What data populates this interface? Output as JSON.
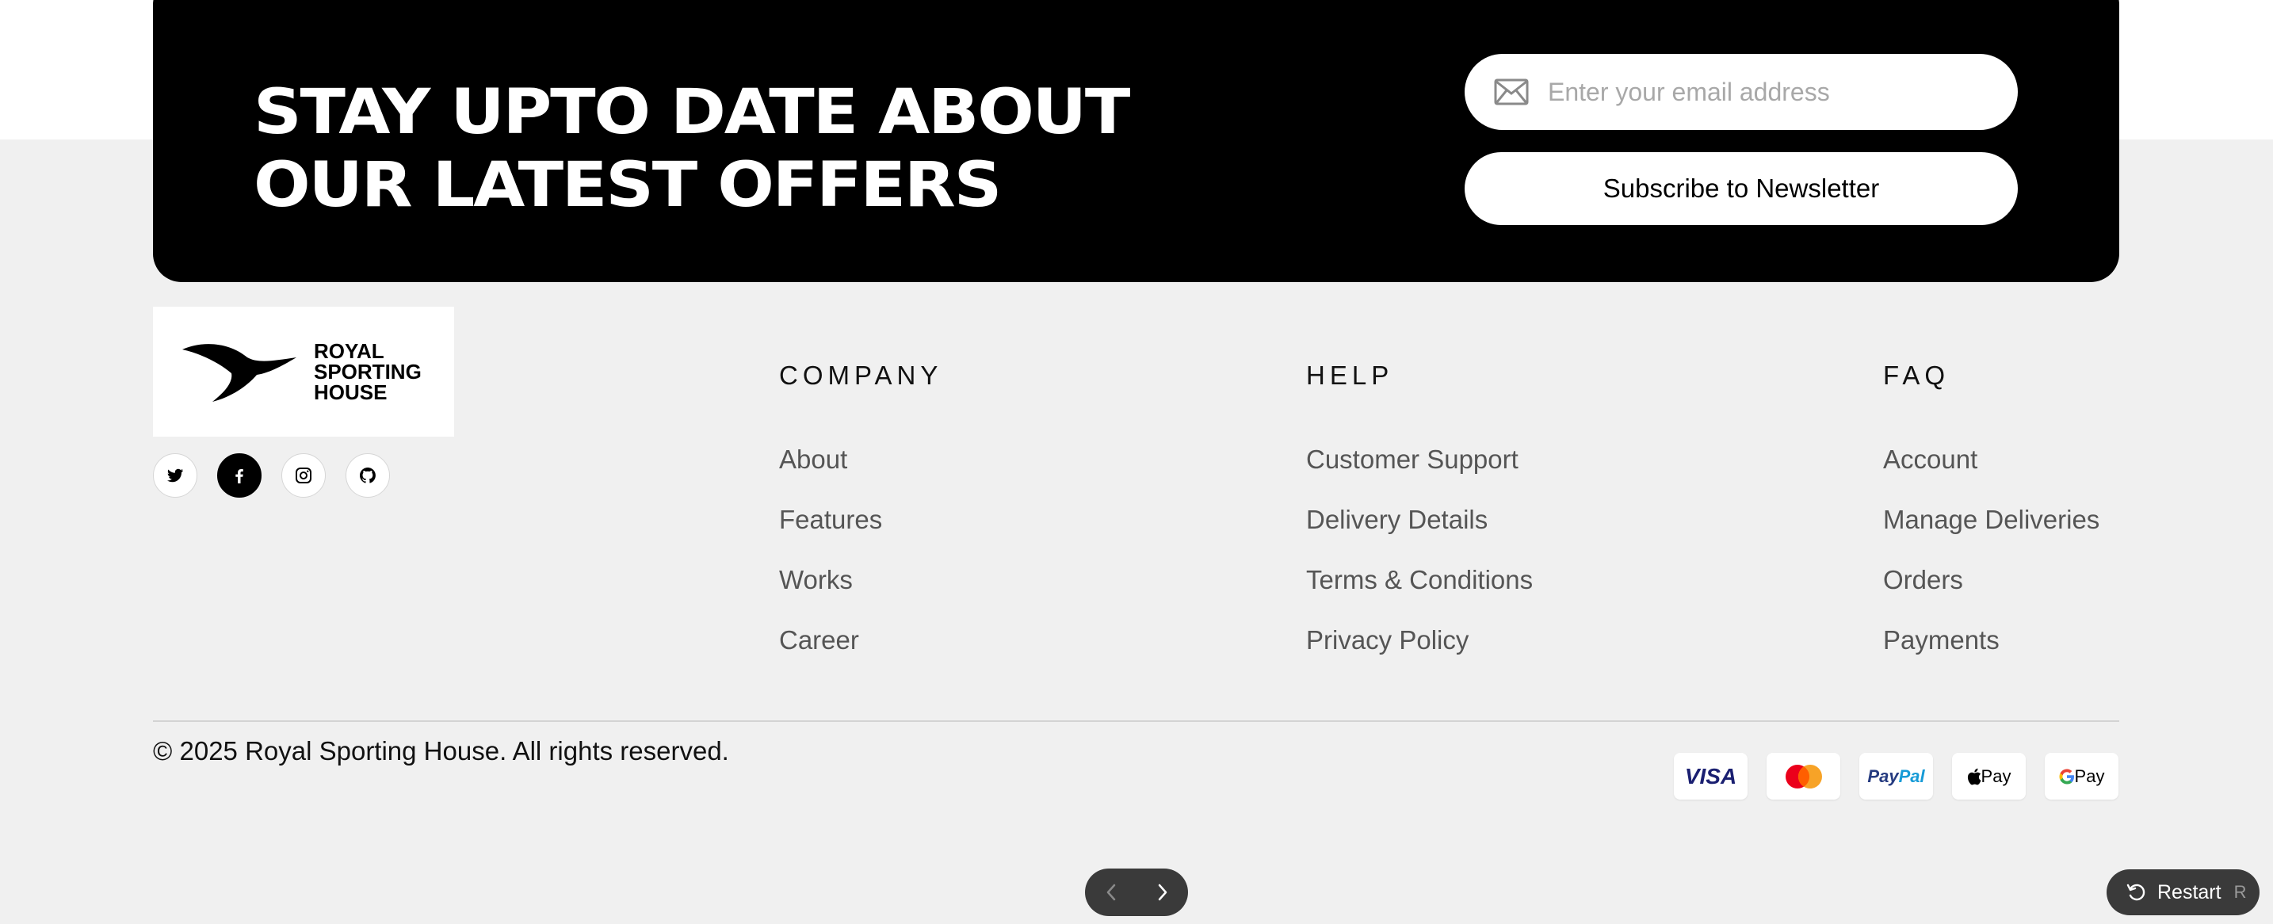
{
  "newsletter": {
    "heading": "STAY UPTO DATE ABOUT\nOUR LATEST OFFERS",
    "email_placeholder": "Enter your email address",
    "subscribe_label": "Subscribe to Newsletter",
    "mail_icon": "envelope-icon"
  },
  "brand": {
    "logo_text": "ROYAL\nSPORTING\nHOUSE"
  },
  "socials": [
    {
      "icon": "twitter-icon"
    },
    {
      "icon": "facebook-icon"
    },
    {
      "icon": "instagram-icon"
    },
    {
      "icon": "github-icon"
    }
  ],
  "columns": {
    "company": {
      "title": "COMPANY",
      "links": [
        "About",
        "Features",
        "Works",
        "Career"
      ]
    },
    "help": {
      "title": "HELP",
      "links": [
        "Customer Support",
        "Delivery Details",
        "Terms & Conditions",
        "Privacy Policy"
      ]
    },
    "faq": {
      "title": "FAQ",
      "links": [
        "Account",
        "Manage Deliveries",
        "Orders",
        "Payments"
      ]
    }
  },
  "copyright": "© 2025 Royal Sporting House. All rights reserved.",
  "payments": {
    "visa": "VISA",
    "paypal_a": "Pay",
    "paypal_b": "Pal",
    "applepay": "Pay",
    "googlepay": "Pay"
  },
  "controls": {
    "restart_label": "Restart",
    "restart_key": "R"
  },
  "colors": {
    "page_background": "#f0f0f0",
    "banner_background": "#000000",
    "link_text": "#555555",
    "control_background": "#3a3a3a"
  }
}
